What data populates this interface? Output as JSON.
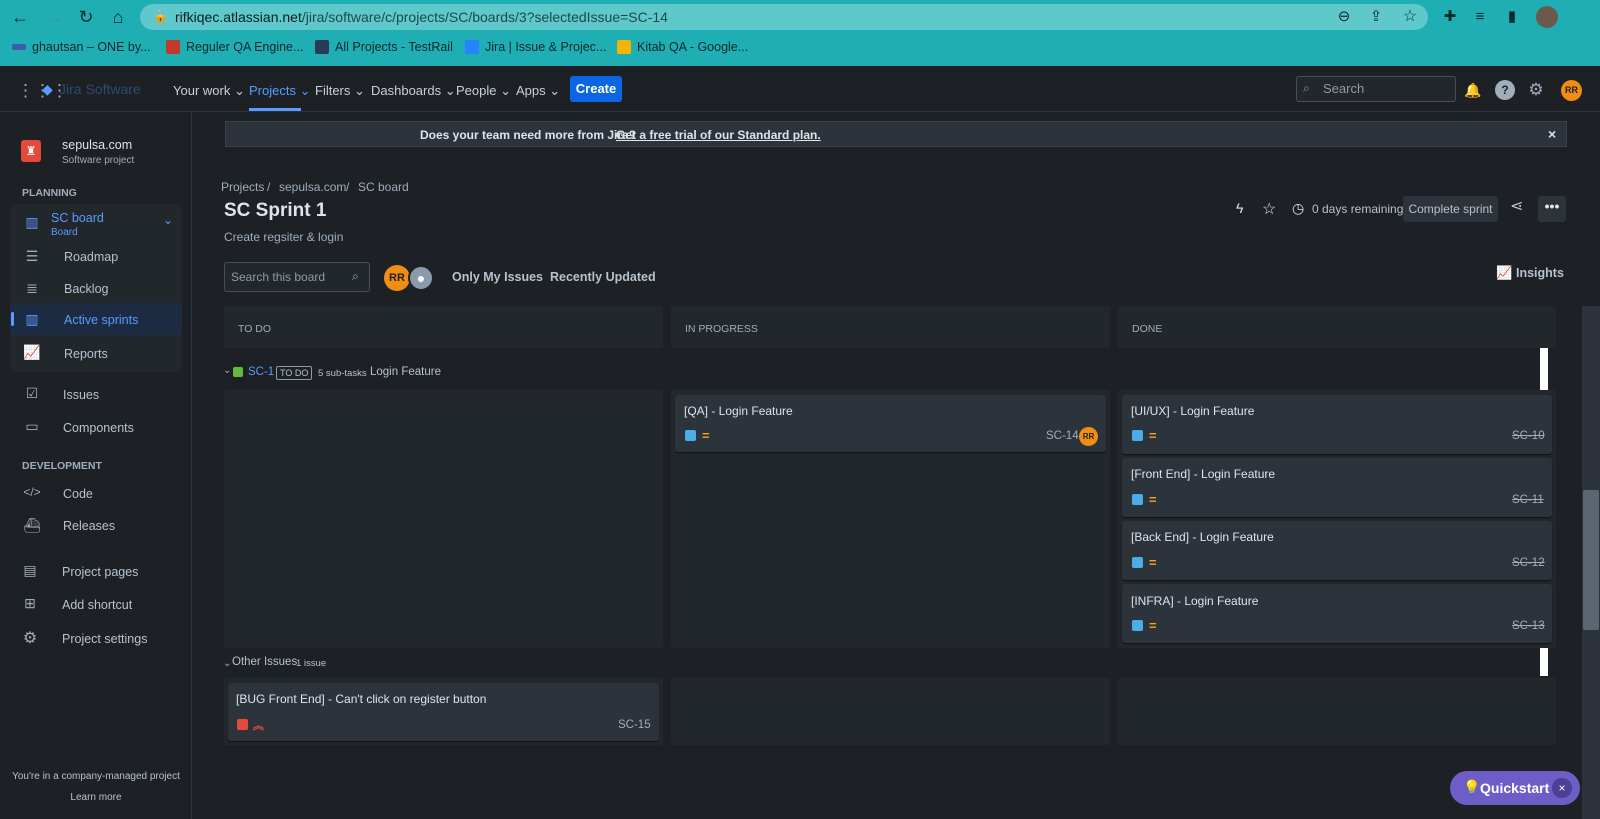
{
  "browser": {
    "url_host": "rifkiqec.atlassian.net",
    "url_path": "/jira/software/c/projects/SC/boards/3?selectedIssue=SC-14",
    "bookmarks": [
      "ghautsan – ONE by...",
      "Reguler QA Engine...",
      "All Projects - TestRail",
      "Jira | Issue & Projec...",
      "Kitab QA - Google..."
    ]
  },
  "topnav": {
    "logo": "Jira Software",
    "items": [
      "Your work",
      "Projects",
      "Filters",
      "Dashboards",
      "People",
      "Apps"
    ],
    "create": "Create",
    "search_placeholder": "Search",
    "avatar": "RR"
  },
  "sidebar": {
    "project_name": "sepulsa.com",
    "project_type": "Software project",
    "planning_header": "PLANNING",
    "board_name": "SC board",
    "board_sub": "Board",
    "planning_items": [
      "Roadmap",
      "Backlog",
      "Active sprints",
      "Reports"
    ],
    "other_items": [
      "Issues",
      "Components"
    ],
    "development_header": "DEVELOPMENT",
    "dev_items": [
      "Code",
      "Releases"
    ],
    "bottom_items": [
      "Project pages",
      "Add shortcut",
      "Project settings"
    ],
    "footer": "You're in a company-managed project",
    "learn_more": "Learn more"
  },
  "banner": {
    "text": "Does your team need more from Jira?",
    "link": "Get a free trial of our Standard plan.",
    "close": "×"
  },
  "breadcrumb": [
    "Projects",
    "sepulsa.com",
    "SC board"
  ],
  "sprint": {
    "title": "SC Sprint 1",
    "goal": "Create regsiter & login",
    "days_remaining": "0 days remaining",
    "complete": "Complete sprint"
  },
  "filters": {
    "search_placeholder": "Search this board",
    "avatar": "RR",
    "only_my": "Only My Issues",
    "recent": "Recently Updated",
    "insights": "Insights"
  },
  "columns": [
    "TO DO",
    "IN PROGRESS",
    "DONE"
  ],
  "swimlane1": {
    "key": "SC-1",
    "status": "TO DO",
    "subtasks": "5 sub-tasks",
    "summary": "Login Feature",
    "in_progress": [
      {
        "title": "[QA] - Login Feature",
        "key": "SC-14",
        "assignee": "RR"
      }
    ],
    "done": [
      {
        "title": "[UI/UX] - Login Feature",
        "key": "SC-10"
      },
      {
        "title": "[Front End] - Login Feature",
        "key": "SC-11"
      },
      {
        "title": "[Back End] - Login Feature",
        "key": "SC-12"
      },
      {
        "title": "[INFRA] - Login Feature",
        "key": "SC-13"
      }
    ]
  },
  "swimlane2": {
    "label": "Other Issues",
    "count": "1 issue",
    "todo": [
      {
        "title": "[BUG Front End] - Can't click on register button",
        "key": "SC-15"
      }
    ]
  },
  "quickstart": "Quickstart",
  "colors": {
    "accent": "#579dff",
    "create": "#0c66e4",
    "avatar": "#f18d13",
    "chrome": "#1faeb3",
    "quickstart": "#6e5dc6"
  }
}
